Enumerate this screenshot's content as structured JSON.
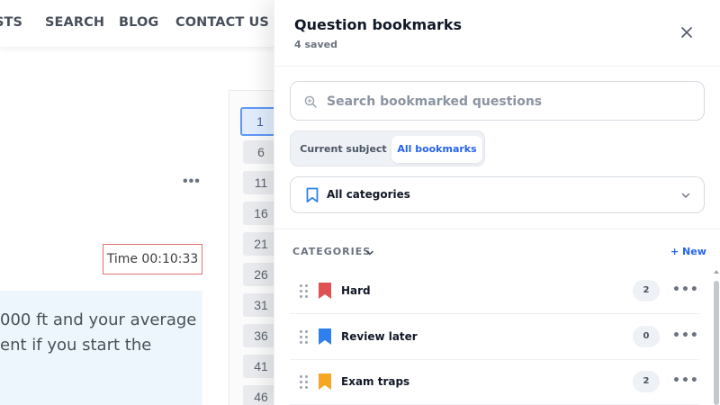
{
  "background": {
    "nav": {
      "lists_label": "STS",
      "search_label": "SEARCH",
      "blog_label": "BLOG",
      "contact_label": "CONTACT US"
    },
    "more_label": "•••",
    "timer_text": "Time 00:10:33",
    "question_lines": [
      "000 ft and your average",
      "ent if you start the"
    ],
    "question_numbers": [
      "1",
      "6",
      "11",
      "16",
      "21",
      "26",
      "31",
      "36",
      "41",
      "46"
    ]
  },
  "drawer": {
    "title": "Question bookmarks",
    "subtitle": "4 saved",
    "close_icon": "close-icon",
    "search": {
      "placeholder": "Search bookmarked questions",
      "value": ""
    },
    "tabs": [
      {
        "label": "Current subject",
        "selected": false
      },
      {
        "label": "All bookmarks",
        "selected": true
      }
    ],
    "category_filter": {
      "label": "All categories",
      "icon": "bookmark-outline-icon"
    },
    "categories_header": "CATEGORIES",
    "new_label": "+ New",
    "categories": [
      {
        "name": "Hard",
        "count": "2",
        "color": "#e05252"
      },
      {
        "name": "Review later",
        "count": "0",
        "color": "#2f80ed"
      },
      {
        "name": "Exam traps",
        "count": "2",
        "color": "#f5a623"
      }
    ],
    "more_label": "•••",
    "accent_color": "#2563eb"
  }
}
